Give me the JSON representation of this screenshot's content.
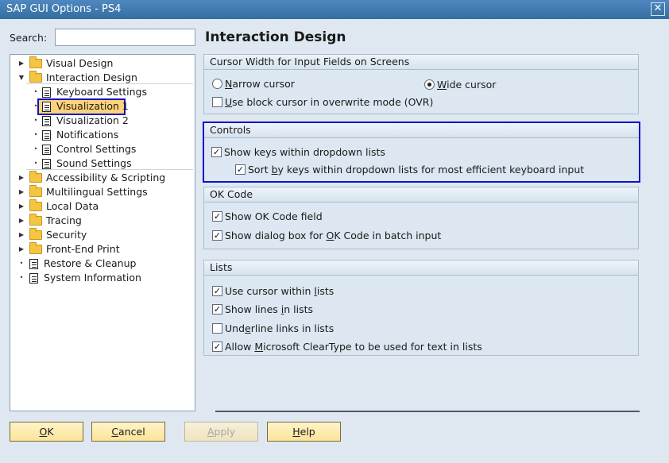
{
  "window": {
    "title": "SAP GUI Options - PS4",
    "close_glyph": "✕"
  },
  "search": {
    "label": "Search:",
    "value": "",
    "placeholder": ""
  },
  "tree": [
    {
      "label": "Visual Design",
      "icon": "folder-icon",
      "toggle": "▶"
    },
    {
      "label": "Interaction Design",
      "icon": "folder-open-icon",
      "toggle": "▼"
    },
    {
      "label": "Keyboard Settings",
      "icon": "document-icon",
      "toggle": "•"
    },
    {
      "label": "Visualization 1",
      "icon": "document-icon",
      "toggle": "•",
      "selected": true
    },
    {
      "label": "Visualization 2",
      "icon": "document-icon",
      "toggle": "•"
    },
    {
      "label": "Notifications",
      "icon": "document-icon",
      "toggle": "•"
    },
    {
      "label": "Control Settings",
      "icon": "document-icon",
      "toggle": "•"
    },
    {
      "label": "Sound Settings",
      "icon": "document-icon",
      "toggle": "•"
    },
    {
      "label": "Accessibility & Scripting",
      "icon": "folder-icon",
      "toggle": "▶"
    },
    {
      "label": "Multilingual Settings",
      "icon": "folder-icon",
      "toggle": "▶"
    },
    {
      "label": "Local Data",
      "icon": "folder-icon",
      "toggle": "▶"
    },
    {
      "label": "Tracing",
      "icon": "folder-icon",
      "toggle": "▶"
    },
    {
      "label": "Security",
      "icon": "folder-icon",
      "toggle": "▶"
    },
    {
      "label": "Front-End Print",
      "icon": "folder-icon",
      "toggle": "▶"
    },
    {
      "label": "Restore & Cleanup",
      "icon": "document-icon",
      "toggle": "•"
    },
    {
      "label": "System Information",
      "icon": "document-icon",
      "toggle": "•"
    }
  ],
  "main": {
    "title": "Interaction Design",
    "cursor_group": {
      "title": "Cursor Width for Input Fields on Screens",
      "narrow": {
        "mn": "N",
        "rest": "arrow cursor",
        "checked": false
      },
      "wide": {
        "mn": "W",
        "rest": "ide cursor",
        "checked": true
      },
      "block": {
        "mn": "U",
        "rest": "se block cursor in overwrite mode (OVR)",
        "checked": false
      }
    },
    "controls_group": {
      "title": "Controls",
      "show_keys": {
        "text": "Show keys within dropdown lists",
        "checked": true
      },
      "sort_by_keys": {
        "pre": "Sort ",
        "mn": "b",
        "post": "y keys within dropdown lists for most efficient keyboard input",
        "checked": true
      }
    },
    "okcode_group": {
      "title": "OK Code",
      "show_field": {
        "text": "Show OK Code field",
        "checked": true
      },
      "dialog": {
        "pre": "Show dialog box for ",
        "mn": "O",
        "post": "K Code in batch input",
        "checked": true
      }
    },
    "lists_group": {
      "title": "Lists",
      "cursor": {
        "pre": "Use cursor within ",
        "mn": "l",
        "post": "ists",
        "checked": true
      },
      "lines": {
        "pre": "Show lines ",
        "mn": "i",
        "post": "n lists",
        "checked": true
      },
      "underline": {
        "pre": "Und",
        "mn": "e",
        "post": "rline links in lists",
        "checked": false
      },
      "cleartype": {
        "pre": "Allow ",
        "mn": "M",
        "post": "icrosoft ClearType to be used for text in lists",
        "checked": true
      }
    }
  },
  "buttons": {
    "ok": {
      "mn": "O",
      "rest": "K"
    },
    "cancel": {
      "mn": "C",
      "rest": "ancel"
    },
    "apply": {
      "mn": "A",
      "rest": "pply",
      "enabled": false
    },
    "help": {
      "mn": "H",
      "rest": "elp"
    }
  },
  "colors": {
    "highlight": "#1010c8",
    "selection": "#fdd27a",
    "titlebar": "#346d9f"
  }
}
